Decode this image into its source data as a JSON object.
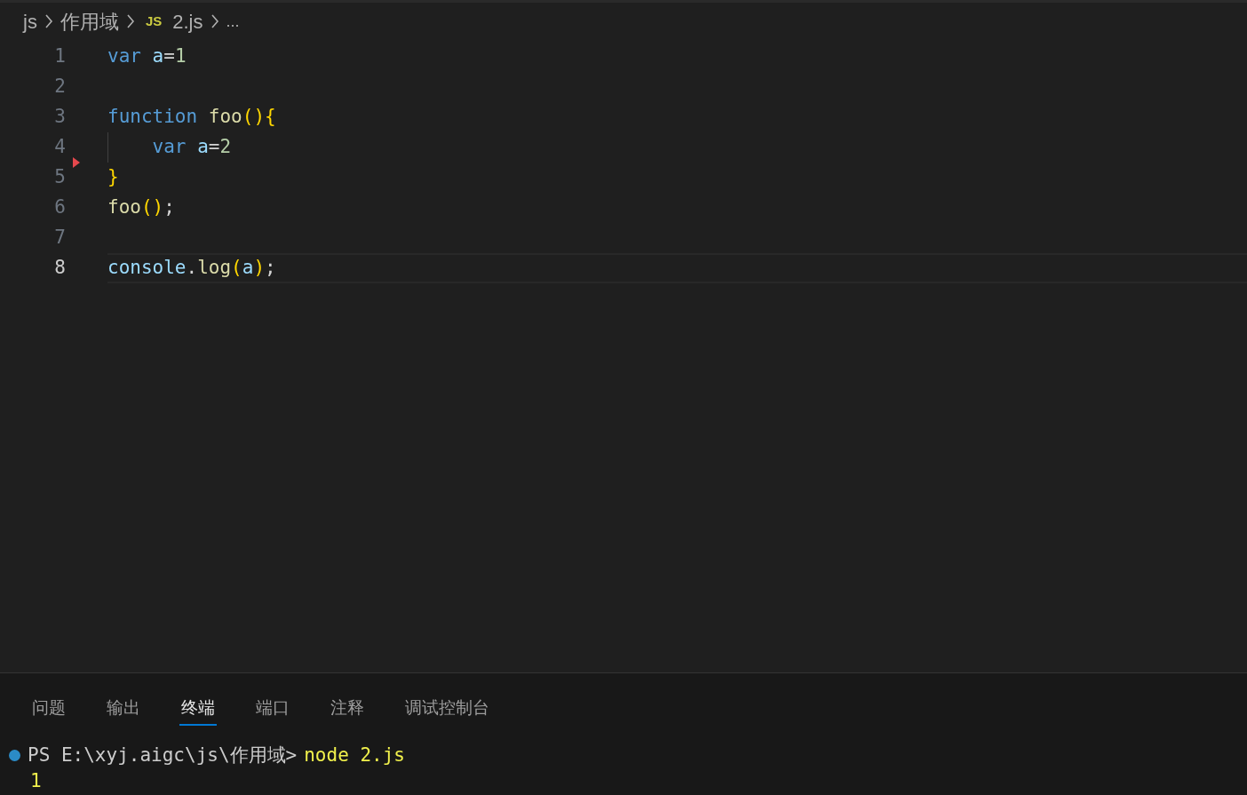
{
  "breadcrumbs": [
    {
      "kind": "folder",
      "text": "js"
    },
    {
      "kind": "folder",
      "text": "作用域"
    },
    {
      "kind": "jsfile",
      "badge": "JS",
      "text": "2.js"
    },
    {
      "kind": "more",
      "text": "..."
    }
  ],
  "editor": {
    "lines": [
      {
        "number": "1",
        "current": false,
        "indent_guide": false,
        "tokens": [
          {
            "kind": "keyword",
            "text": "var "
          },
          {
            "kind": "variable",
            "text": "a"
          },
          {
            "kind": "plain",
            "text": "="
          },
          {
            "kind": "number",
            "text": "1"
          }
        ]
      },
      {
        "number": "2",
        "current": false,
        "indent_guide": false
      },
      {
        "number": "3",
        "current": false,
        "indent_guide": false,
        "tokens": [
          {
            "kind": "keyword",
            "text": "function "
          },
          {
            "kind": "function",
            "text": "foo"
          },
          {
            "kind": "bracket",
            "text": "(){"
          }
        ]
      },
      {
        "number": "4",
        "current": false,
        "indent_guide": true,
        "tokens": [
          {
            "kind": "keyword",
            "text": "var "
          },
          {
            "kind": "variable",
            "text": "a"
          },
          {
            "kind": "plain",
            "text": "="
          },
          {
            "kind": "number",
            "text": "2"
          }
        ]
      },
      {
        "number": "5",
        "current": false,
        "indent_guide": false,
        "tokens": [
          {
            "kind": "bracket",
            "text": "}"
          }
        ]
      },
      {
        "number": "6",
        "current": false,
        "indent_guide": false,
        "tokens": [
          {
            "kind": "function",
            "text": "foo"
          },
          {
            "kind": "bracket",
            "text": "()"
          },
          {
            "kind": "plain",
            "text": ";"
          }
        ]
      },
      {
        "number": "7",
        "current": false,
        "indent_guide": false
      },
      {
        "number": "8",
        "current": true,
        "indent_guide": false,
        "tokens": [
          {
            "kind": "variable",
            "text": "console"
          },
          {
            "kind": "plain",
            "text": "."
          },
          {
            "kind": "function",
            "text": "log"
          },
          {
            "kind": "bracket",
            "text": "("
          },
          {
            "kind": "variable",
            "text": "a"
          },
          {
            "kind": "bracket",
            "text": ")"
          },
          {
            "kind": "plain",
            "text": ";"
          }
        ]
      }
    ]
  },
  "panel": {
    "tabs": [
      {
        "label": "问题",
        "selected": false
      },
      {
        "label": "输出",
        "selected": false
      },
      {
        "label": "终端",
        "selected": true
      },
      {
        "label": "端口",
        "selected": false
      },
      {
        "label": "注释",
        "selected": false
      },
      {
        "label": "调试控制台",
        "selected": false
      }
    ],
    "terminal": {
      "prompt": "PS E:\\xyj.aigc\\js\\作用域>",
      "command": "node 2.js",
      "output": "1"
    }
  }
}
